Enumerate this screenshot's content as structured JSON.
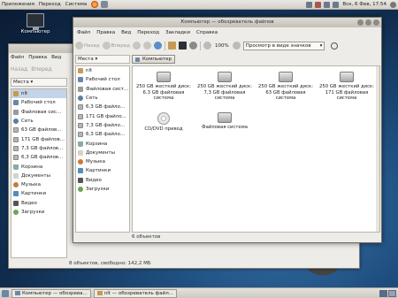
{
  "top_panel": {
    "menus": [
      "Приложения",
      "Переход",
      "Система"
    ],
    "clock": "Вск, 6 Фев, 17:54"
  },
  "desktop": {
    "icon_label": "Компьютер"
  },
  "back_window": {
    "menus": [
      "Файл",
      "Правка",
      "Вид"
    ],
    "toolbar": [
      "Назад",
      "Вперед"
    ],
    "places_header": "Места ▾",
    "places": [
      {
        "label": "nlt",
        "icon": "home",
        "selected": true
      },
      {
        "label": "Рабочий стол",
        "icon": "desk"
      },
      {
        "label": "Файловая сис...",
        "icon": "fs"
      },
      {
        "label": "Сеть",
        "icon": "net"
      },
      {
        "label": "63 GB файлов...",
        "icon": "drive"
      },
      {
        "label": "171 GB файлов...",
        "icon": "drive"
      },
      {
        "label": "7,3 GB файлов...",
        "icon": "drive"
      },
      {
        "label": "6,3 GB файлов...",
        "icon": "drive"
      },
      {
        "label": "Корзина",
        "icon": "trash"
      },
      {
        "label": "Документы",
        "icon": "doc"
      },
      {
        "label": "Музыка",
        "icon": "music"
      },
      {
        "label": "Картинки",
        "icon": "pic"
      },
      {
        "label": "Видео",
        "icon": "video"
      },
      {
        "label": "Загрузки",
        "icon": "dl"
      }
    ],
    "status": "8 объектов, свободно: 142,2 МБ"
  },
  "front_window": {
    "title": "Компьютер — обозреватель файлов",
    "menus": [
      "Файл",
      "Правка",
      "Вид",
      "Переход",
      "Закладки",
      "Справка"
    ],
    "toolbar": {
      "back": "Назад",
      "forward": "Вперед",
      "zoom": "100%",
      "view_mode": "Просмотр в виде значков"
    },
    "places_header": "Места ▾",
    "path_button": "Компьютер",
    "places": [
      {
        "label": "nlt",
        "icon": "home"
      },
      {
        "label": "Рабочий стол",
        "icon": "desk"
      },
      {
        "label": "Файловая сист...",
        "icon": "fs"
      },
      {
        "label": "Сеть",
        "icon": "net"
      },
      {
        "label": "6,3 GB файло...",
        "icon": "drive"
      },
      {
        "label": "171 GB файло...",
        "icon": "drive"
      },
      {
        "label": "7,3 GB файло...",
        "icon": "drive"
      },
      {
        "label": "6,3 GB файло...",
        "icon": "drive"
      },
      {
        "label": "Корзина",
        "icon": "trash"
      },
      {
        "label": "Документы",
        "icon": "doc"
      },
      {
        "label": "Музыка",
        "icon": "music"
      },
      {
        "label": "Картинки",
        "icon": "pic"
      },
      {
        "label": "Видео",
        "icon": "video"
      },
      {
        "label": "Загрузки",
        "icon": "dl"
      }
    ],
    "items": [
      {
        "label": "250 GB жесткий диск: 6,3 GB файловая система",
        "icon": "hdd"
      },
      {
        "label": "250 GB жесткий диск: 7,3 GB файловая система",
        "icon": "hdd"
      },
      {
        "label": "250 GB жесткий диск: 63 GB файловая система",
        "icon": "hdd"
      },
      {
        "label": "250 GB жесткий диск: 171 GB файловая система",
        "icon": "hdd"
      },
      {
        "label": "CD/DVD привод",
        "icon": "cd"
      },
      {
        "label": "Файловая система",
        "icon": "hdd"
      }
    ],
    "status": "6 объектов"
  },
  "taskbar": {
    "tasks": [
      {
        "label": "Компьютер — обозрева...",
        "active": false
      },
      {
        "label": "nlt — обозреватель файл...",
        "active": false
      }
    ]
  }
}
